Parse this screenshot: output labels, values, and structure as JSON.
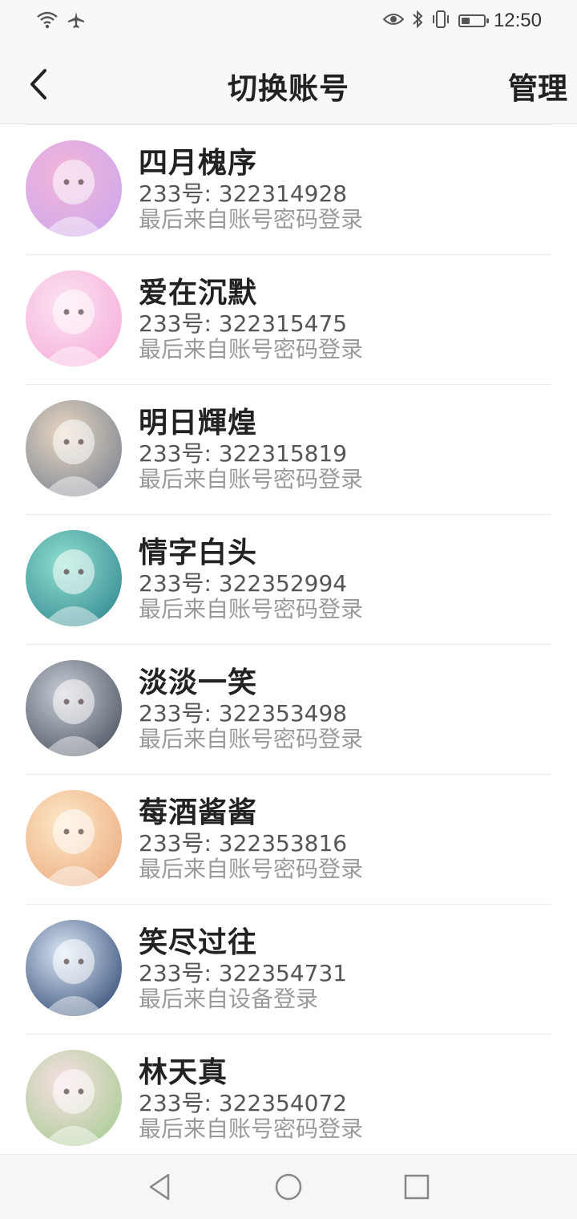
{
  "status_bar": {
    "time": "12:50",
    "icons_left": [
      "wifi-icon",
      "airplane-icon"
    ],
    "icons_right": [
      "eye-icon",
      "bluetooth-icon",
      "vibrate-icon",
      "battery-icon"
    ],
    "battery_level": 0.4
  },
  "header": {
    "title": "切换账号",
    "manage_label": "管理",
    "back_icon": "chevron-left-icon"
  },
  "accounts": [
    {
      "name": "四月槐序",
      "uid": "233号: 322314928",
      "login": "最后来自账号密码登录",
      "avatar_colors": [
        "#f3b6d8",
        "#c8a6f0"
      ]
    },
    {
      "name": "爱在沉默",
      "uid": "233号: 322315475",
      "login": "最后来自账号密码登录",
      "avatar_colors": [
        "#fbe3f2",
        "#f6a8d6"
      ]
    },
    {
      "name": "明日輝煌",
      "uid": "233号: 322315819",
      "login": "最后来自账号密码登录",
      "avatar_colors": [
        "#e9d7c1",
        "#6d7a8c"
      ]
    },
    {
      "name": "情字白头",
      "uid": "233号: 322352994",
      "login": "最后来自账号密码登录",
      "avatar_colors": [
        "#8fe0cf",
        "#2a7f8a"
      ]
    },
    {
      "name": "淡淡一笑",
      "uid": "233号: 322353498",
      "login": "最后来自账号密码登录",
      "avatar_colors": [
        "#c9ced6",
        "#3c4452"
      ]
    },
    {
      "name": "莓酒酱酱",
      "uid": "233号: 322353816",
      "login": "最后来自账号密码登录",
      "avatar_colors": [
        "#fde9c7",
        "#e9a57a"
      ]
    },
    {
      "name": "笑尽过往",
      "uid": "233号: 322354731",
      "login": "最后来自设备登录",
      "avatar_colors": [
        "#dbe8f6",
        "#1f3a66"
      ]
    },
    {
      "name": "林天真",
      "uid": "233号: 322354072",
      "login": "最后来自账号密码登录",
      "avatar_colors": [
        "#f8dfe4",
        "#9ecb8a"
      ]
    }
  ],
  "nav_bar": {
    "buttons": [
      "nav-back-icon",
      "nav-home-icon",
      "nav-recents-icon"
    ]
  }
}
